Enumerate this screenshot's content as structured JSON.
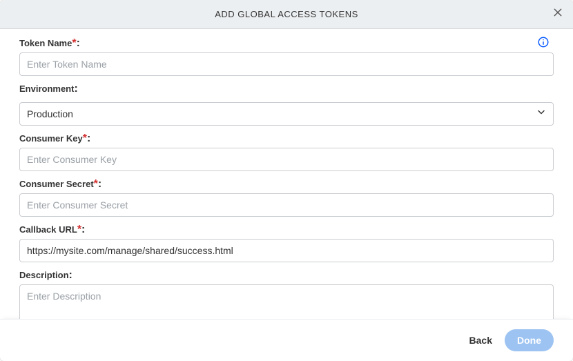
{
  "dialog": {
    "title": "ADD GLOBAL ACCESS TOKENS"
  },
  "form": {
    "token_name": {
      "label": "Token Name",
      "required": true,
      "placeholder": "Enter Token Name",
      "value": ""
    },
    "environment": {
      "label": "Environment",
      "required": false,
      "selected": "Production"
    },
    "consumer_key": {
      "label": "Consumer Key",
      "required": true,
      "placeholder": "Enter Consumer Key",
      "value": ""
    },
    "consumer_secret": {
      "label": "Consumer Secret",
      "required": true,
      "placeholder": "Enter Consumer Secret",
      "value": ""
    },
    "callback_url": {
      "label": "Callback URL",
      "required": true,
      "placeholder": "",
      "value": "https://mysite.com/manage/shared/success.html"
    },
    "description": {
      "label": "Description",
      "required": false,
      "placeholder": "Enter Description",
      "value": ""
    }
  },
  "footer": {
    "back_label": "Back",
    "done_label": "Done"
  },
  "punct": {
    "asterisk": "*",
    "colon": ":"
  }
}
